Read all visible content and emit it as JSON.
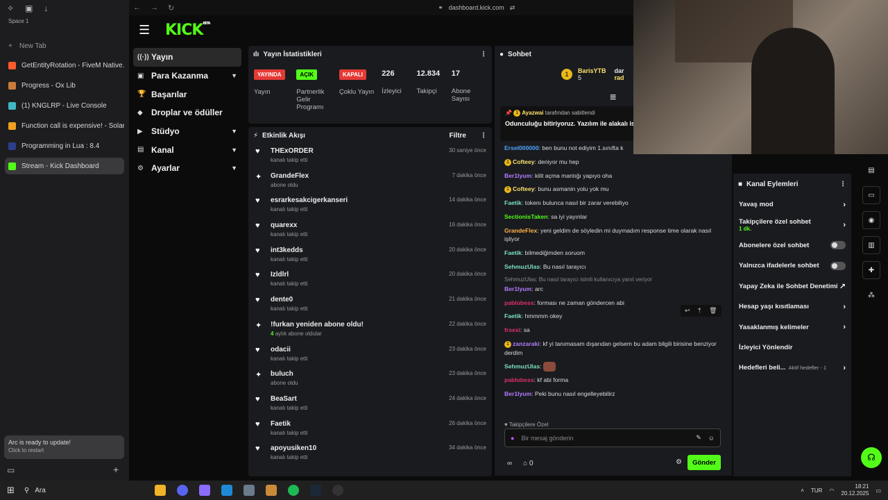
{
  "browser": {
    "space": "Space 1",
    "new_tab": "New Tab",
    "url": "dashboard.kick.com",
    "tabs": [
      {
        "label": "GetEntityRotation - FiveM Native...",
        "color": "#ff5a2c"
      },
      {
        "label": "Progress - Ox Lib",
        "color": "#c97b3b"
      },
      {
        "label": "(1) KNGLRP - Live Console",
        "color": "#3fb8c6"
      },
      {
        "label": "Function call is expensive! - Solar...",
        "color": "#f0a020"
      },
      {
        "label": "Programming in Lua : 8.4",
        "color": "#2c3e8c"
      },
      {
        "label": "Stream - Kick Dashboard",
        "color": "#53fc18"
      }
    ],
    "update_title": "Arc is ready to update!",
    "update_sub": "Click to restart"
  },
  "kick": {
    "logo": "KICK",
    "beta": "BETA",
    "menu": [
      {
        "label": "Yayın",
        "chevron": false
      },
      {
        "label": "Para Kazanma",
        "chevron": true
      },
      {
        "label": "Başarılar",
        "chevron": false
      },
      {
        "label": "Droplar ve ödüller",
        "chevron": false
      },
      {
        "label": "Stüdyo",
        "chevron": true
      },
      {
        "label": "Kanal",
        "chevron": true
      },
      {
        "label": "Ayarlar",
        "chevron": true
      }
    ]
  },
  "stats": {
    "title": "Yayın İstatistikleri",
    "items": [
      {
        "badge": "YAYINDA",
        "badge_color": "#e53935",
        "label": "Yayın"
      },
      {
        "badge": "AÇIK",
        "badge_color": "#53fc18",
        "label": "Partnerlik Gelir Programı"
      },
      {
        "badge": "KAPALI",
        "badge_color": "#e53935",
        "label": "Çoklu Yayın"
      }
    ],
    "numbers": [
      {
        "value": "226",
        "label": "İzleyici"
      },
      {
        "value": "12.834",
        "label": "Takipçi"
      },
      {
        "value": "17",
        "label": "Abone Sayısı"
      }
    ]
  },
  "feed": {
    "title": "Etkinlik Akışı",
    "filter": "Filtre",
    "items": [
      {
        "name": "THExORDER",
        "sub": "kanalı takip etti",
        "time": "30 saniye önce",
        "icon": "♥"
      },
      {
        "name": "GrandeFlex",
        "sub": "abone oldu",
        "time": "7 dakika önce",
        "icon": "✦"
      },
      {
        "name": "esrarkesakcigerkanseri",
        "sub": "kanalı takip etti",
        "time": "14 dakika önce",
        "icon": "♥"
      },
      {
        "name": "quarexx",
        "sub": "kanalı takip etti",
        "time": "16 dakika önce",
        "icon": "♥"
      },
      {
        "name": "int3kedds",
        "sub": "kanalı takip etti",
        "time": "20 dakika önce",
        "icon": "♥"
      },
      {
        "name": "Izldlrl",
        "sub": "kanalı takip etti",
        "time": "20 dakika önce",
        "icon": "♥"
      },
      {
        "name": "dente0",
        "sub": "kanalı takip etti",
        "time": "21 dakika önce",
        "icon": "♥"
      },
      {
        "name": "!furkan yeniden abone oldu!",
        "sub_num": "4",
        "sub": "aylık abone oldular",
        "time": "22 dakika önce",
        "icon": "✦"
      },
      {
        "name": "odacii",
        "sub": "kanalı takip etti",
        "time": "23 dakika önce",
        "icon": "♥"
      },
      {
        "name": "buluch",
        "sub": "abone oldu",
        "time": "23 dakika önce",
        "icon": "✦"
      },
      {
        "name": "BeaSart",
        "sub": "kanalı takip etti",
        "time": "24 dakika önce",
        "icon": "♥"
      },
      {
        "name": "Faetik",
        "sub": "kanalı takip etti",
        "time": "26 dakika önce",
        "icon": "♥"
      },
      {
        "name": "apoyusiken10",
        "sub": "kanalı takip etti",
        "time": "34 dakika önce",
        "icon": "♥"
      }
    ]
  },
  "chat": {
    "title": "Sohbet",
    "top_user": "BarisYTB",
    "top_count": "5",
    "top_user2": "dar",
    "top_user3": "rad",
    "pinned_by": "Ayazwai",
    "pinned_suffix": "tarafından sabitlendi",
    "pinned_text": "Odunculuğu bitiriyoruz. Yazılım ile alakalı istemeyin.",
    "reply_note": "SehmuzUlas: Bu nasıl tarayıcı isimli kullanıcıya yanıt veriyor",
    "messages": [
      {
        "user": "Ersel000000",
        "color": "#4fa3ff",
        "text": "ben bunu not ediyim 1.sınıfta k"
      },
      {
        "user": "Cofteey",
        "color": "#ffe16b",
        "text": "deniyor mu hep",
        "badge": "1"
      },
      {
        "user": "Ber1lyum",
        "color": "#b37bff",
        "text": "kilit açma mantığı yapıyo oha"
      },
      {
        "user": "Cofteey",
        "color": "#ffe16b",
        "text": "bunu asmanin yolu yok mu",
        "badge": "1"
      },
      {
        "user": "Faetik",
        "color": "#7fe0c0",
        "text": "tokenı bulunca nasıl bir zarar verebiliyo"
      },
      {
        "user": "SectionisTaken",
        "color": "#53fc18",
        "text": "sa iyi yayınlar"
      },
      {
        "user": "GrandeFlex",
        "color": "#ffb347",
        "text": "yeni geldim de söyledin mi duymadım response time olarak nasıl işliyor"
      },
      {
        "user": "Faetik",
        "color": "#7fe0c0",
        "text": "bilmediğimden soruom"
      },
      {
        "user": "SehmuzUlas",
        "color": "#7fe0c0",
        "text": "Bu nasıl tarayıcı"
      },
      {
        "user": "Ber1lyum",
        "color": "#b37bff",
        "text": "arc"
      },
      {
        "user": "pablobess",
        "color": "#e0306a",
        "text": "forması ne zaman göndercen abi"
      },
      {
        "user": "Faetik",
        "color": "#7fe0c0",
        "text": "hmmmm okey"
      },
      {
        "user": "frsexi",
        "color": "#e0306a",
        "text": "sa"
      },
      {
        "user": "zanzaraki",
        "color": "#b37bff",
        "text": "kf yi tanımasam dışarıdan gelsem bu adam bilgili birisine benziyor derdim",
        "badge": "1"
      },
      {
        "user": "SehmuzUlas",
        "color": "#7fe0c0",
        "text": ""
      },
      {
        "user": "pablobess",
        "color": "#e0306a",
        "text": "kf abi forma"
      },
      {
        "user": "Ber1lyum",
        "color": "#b37bff",
        "text": "Peki bunu nasıl engelleyebilirz"
      }
    ],
    "followers_only": "Takipçilere Özel",
    "input_placeholder": "Bir mesaj gönderin",
    "send": "Gönder",
    "points": "0"
  },
  "channel_actions": {
    "title": "Kanal Eylemleri",
    "items": [
      {
        "label": "Yavaş mod",
        "type": "chevron"
      },
      {
        "label": "Takipçilere özel sohbet",
        "sub": "1 dk.",
        "type": "chevron"
      },
      {
        "label": "Abonelere özel sohbet",
        "type": "toggle"
      },
      {
        "label": "Yalnızca ifadelerle sohbet",
        "type": "toggle"
      },
      {
        "label": "Yapay Zeka ile Sohbet Denetimi",
        "type": "external"
      },
      {
        "label": "Hesap yaşı kısıtlaması",
        "type": "chevron"
      },
      {
        "label": "Yasaklanmış kelimeler",
        "type": "chevron"
      },
      {
        "label": "İzleyici Yönlendir",
        "type": "none"
      },
      {
        "label": "Hedefleri beli...",
        "sub2": "Aktif hedefler - 1",
        "type": "chevron"
      }
    ]
  },
  "taskbar": {
    "search": "Ara",
    "lang": "TUR",
    "time": "18:21",
    "date": "20.12.2025"
  }
}
